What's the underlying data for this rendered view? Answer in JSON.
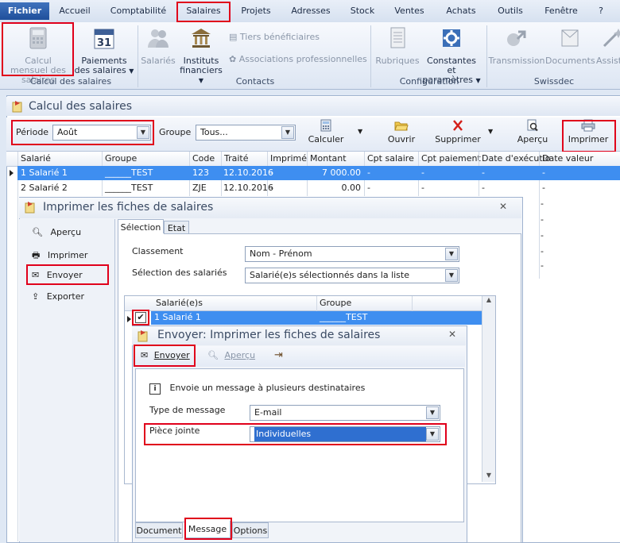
{
  "menu": {
    "items": [
      "Fichier",
      "Accueil",
      "Comptabilité",
      "Salaires",
      "Projets",
      "Adresses",
      "Stock",
      "Ventes",
      "Achats",
      "Outils",
      "Fenêtre",
      "?"
    ]
  },
  "ribbon": {
    "calcul_mensuel": "Calcul mensuel des salaires",
    "paiements": "Paiements des salaires",
    "calendar_day": "31",
    "group_calcul": "Calcul des salaires",
    "salaries": "Salariés",
    "instituts": "Instituts financiers",
    "tiers": "Tiers bénéficiaires",
    "associations": "Associations professionnelles",
    "group_contacts": "Contacts",
    "rubriques": "Rubriques",
    "constantes": "Constantes et paramètres",
    "group_configuration": "Configuration",
    "transmission": "Transmission",
    "documents": "Documents",
    "assist": "Assist",
    "group_swissdec": "Swissdec"
  },
  "main": {
    "title": "Calcul des salaires",
    "periode_label": "Période",
    "periode_value": "Août",
    "groupe_label": "Groupe",
    "groupe_value": "Tous...",
    "btn_calculer": "Calculer",
    "btn_ouvrir": "Ouvrir",
    "btn_supprimer": "Supprimer",
    "btn_apercu": "Aperçu",
    "btn_imprimer": "Imprimer",
    "columns": [
      "Salarié",
      "Groupe",
      "Code",
      "Traité",
      "Imprimé",
      "Montant",
      "Cpt salaire",
      "Cpt paiement",
      "Date d'exécutio",
      "Date valeur"
    ],
    "rows": [
      {
        "salarie": "1 Salarié 1",
        "groupe": "______TEST",
        "code": "123",
        "traite": "12.10.2016",
        "imprime": "-",
        "montant": "7 000.00",
        "cpt_salaire": "-",
        "cpt_paiement": "-",
        "date_exec": "-",
        "date_valeur": "-"
      },
      {
        "salarie": "2 Salarié 2",
        "groupe": "______TEST",
        "code": "ZJE",
        "traite": "12.10.2016",
        "imprime": "-",
        "montant": "0.00",
        "cpt_salaire": "-",
        "cpt_paiement": "-",
        "date_exec": "-",
        "date_valeur": "-"
      }
    ],
    "extra_dash": "-"
  },
  "dialog1": {
    "title": "Imprimer les fiches de salaires",
    "side": [
      "Aperçu",
      "Imprimer",
      "Envoyer",
      "Exporter"
    ],
    "tabs": [
      "Sélection",
      "Etat"
    ],
    "classement_label": "Classement",
    "classement_value": "Nom - Prénom",
    "selection_label": "Sélection des salariés",
    "selection_value": "Salarié(e)s sélectionnés dans la liste",
    "list_cols": [
      "Salarié(e)s",
      "Groupe"
    ],
    "list_row": {
      "name": "1 Salarié 1",
      "groupe": "______TEST"
    }
  },
  "dialog2": {
    "title": "Envoyer: Imprimer les fiches de salaires",
    "btn_envoyer": "Envoyer",
    "btn_apercu": "Aperçu",
    "info": "Envoie un message à plusieurs destinataires",
    "type_label": "Type de message",
    "type_value": "E-mail",
    "piece_label": "Pièce jointe",
    "piece_value": "Individuelles",
    "tabs": [
      "Document",
      "Message",
      "Options"
    ]
  },
  "colors": {
    "accent": "#1f4f9b",
    "selection": "#3e8ef0",
    "highlight": "#e0001b"
  }
}
